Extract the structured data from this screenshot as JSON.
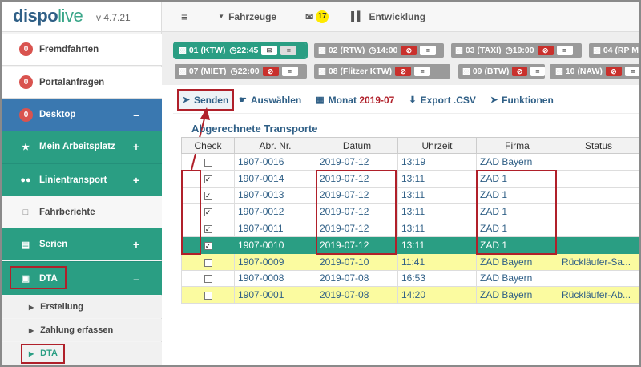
{
  "app": {
    "brand_a": "dispo",
    "brand_b": "live",
    "version": "v 4.7.21"
  },
  "sidebar": {
    "fremdfahrten": {
      "count": "0",
      "label": "Fremdfahrten"
    },
    "portal": {
      "count": "0",
      "label": "Portalanfragen"
    },
    "desktop": {
      "count": "0",
      "label": "Desktop",
      "toggle": "–"
    },
    "arbeitsplatz": {
      "label": "Mein Arbeitsplatz",
      "toggle": "+"
    },
    "linien": {
      "label": "Linientransport",
      "toggle": "+"
    },
    "fahrberichte": {
      "label": "Fahrberichte"
    },
    "serien": {
      "label": "Serien",
      "toggle": "+"
    },
    "dta": {
      "label": "DTA",
      "toggle": "–"
    },
    "sub": [
      {
        "label": "Erstellung"
      },
      {
        "label": "Zahlung erfassen"
      },
      {
        "label": "DTA"
      }
    ]
  },
  "topbar": {
    "menu_icon": "≡",
    "fahrzeuge": "Fahrzeuge",
    "messages_count": "17",
    "entwicklung": "Entwicklung"
  },
  "vehicles": [
    {
      "label": "01 (KTW)",
      "time": "22:45"
    },
    {
      "label": "02 (RTW)",
      "time": "14:00"
    },
    {
      "label": "03 (TAXI)",
      "time": "19:00"
    },
    {
      "label": "04 (RP M",
      "time": ""
    },
    {
      "label": "07 (MIET)",
      "time": "22:00"
    },
    {
      "label": "08 (Flitzer KTW)",
      "time": ""
    },
    {
      "label": "09 (BTW)",
      "time": ""
    },
    {
      "label": "10 (NAW)",
      "time": ""
    }
  ],
  "toolbar": {
    "senden": "Senden",
    "auswaehlen": "Auswählen",
    "monat_label": "Monat",
    "monat_value": "2019-07",
    "export": "Export .CSV",
    "funktionen": "Funktionen"
  },
  "table": {
    "title": "Abgerechnete Transporte",
    "headers": [
      "Check",
      "Abr. Nr.",
      "Datum",
      "Uhrzeit",
      "Firma",
      "Status"
    ],
    "rows": [
      {
        "checked": false,
        "nr": "1907-0016",
        "datum": "2019-07-12",
        "zeit": "13:19",
        "firma": "ZAD Bayern",
        "status": ""
      },
      {
        "checked": true,
        "nr": "1907-0014",
        "datum": "2019-07-12",
        "zeit": "13:11",
        "firma": "ZAD 1",
        "status": ""
      },
      {
        "checked": true,
        "nr": "1907-0013",
        "datum": "2019-07-12",
        "zeit": "13:11",
        "firma": "ZAD 1",
        "status": ""
      },
      {
        "checked": true,
        "nr": "1907-0012",
        "datum": "2019-07-12",
        "zeit": "13:11",
        "firma": "ZAD 1",
        "status": ""
      },
      {
        "checked": true,
        "nr": "1907-0011",
        "datum": "2019-07-12",
        "zeit": "13:11",
        "firma": "ZAD 1",
        "status": ""
      },
      {
        "checked": true,
        "nr": "1907-0010",
        "datum": "2019-07-12",
        "zeit": "13:11",
        "firma": "ZAD 1",
        "status": ""
      },
      {
        "checked": false,
        "nr": "1907-0009",
        "datum": "2019-07-10",
        "zeit": "11:41",
        "firma": "ZAD Bayern",
        "status": "Rückläufer-Sa..."
      },
      {
        "checked": false,
        "nr": "1907-0008",
        "datum": "2019-07-08",
        "zeit": "16:53",
        "firma": "ZAD Bayern",
        "status": ""
      },
      {
        "checked": false,
        "nr": "1907-0001",
        "datum": "2019-07-08",
        "zeit": "14:20",
        "firma": "ZAD Bayern",
        "status": "Rückläufer-Ab..."
      }
    ]
  },
  "colors": {
    "green": "#2a9e83",
    "blue": "#3a78b0",
    "highlight": "#b0202a",
    "yellow_row": "#fbfba0"
  }
}
